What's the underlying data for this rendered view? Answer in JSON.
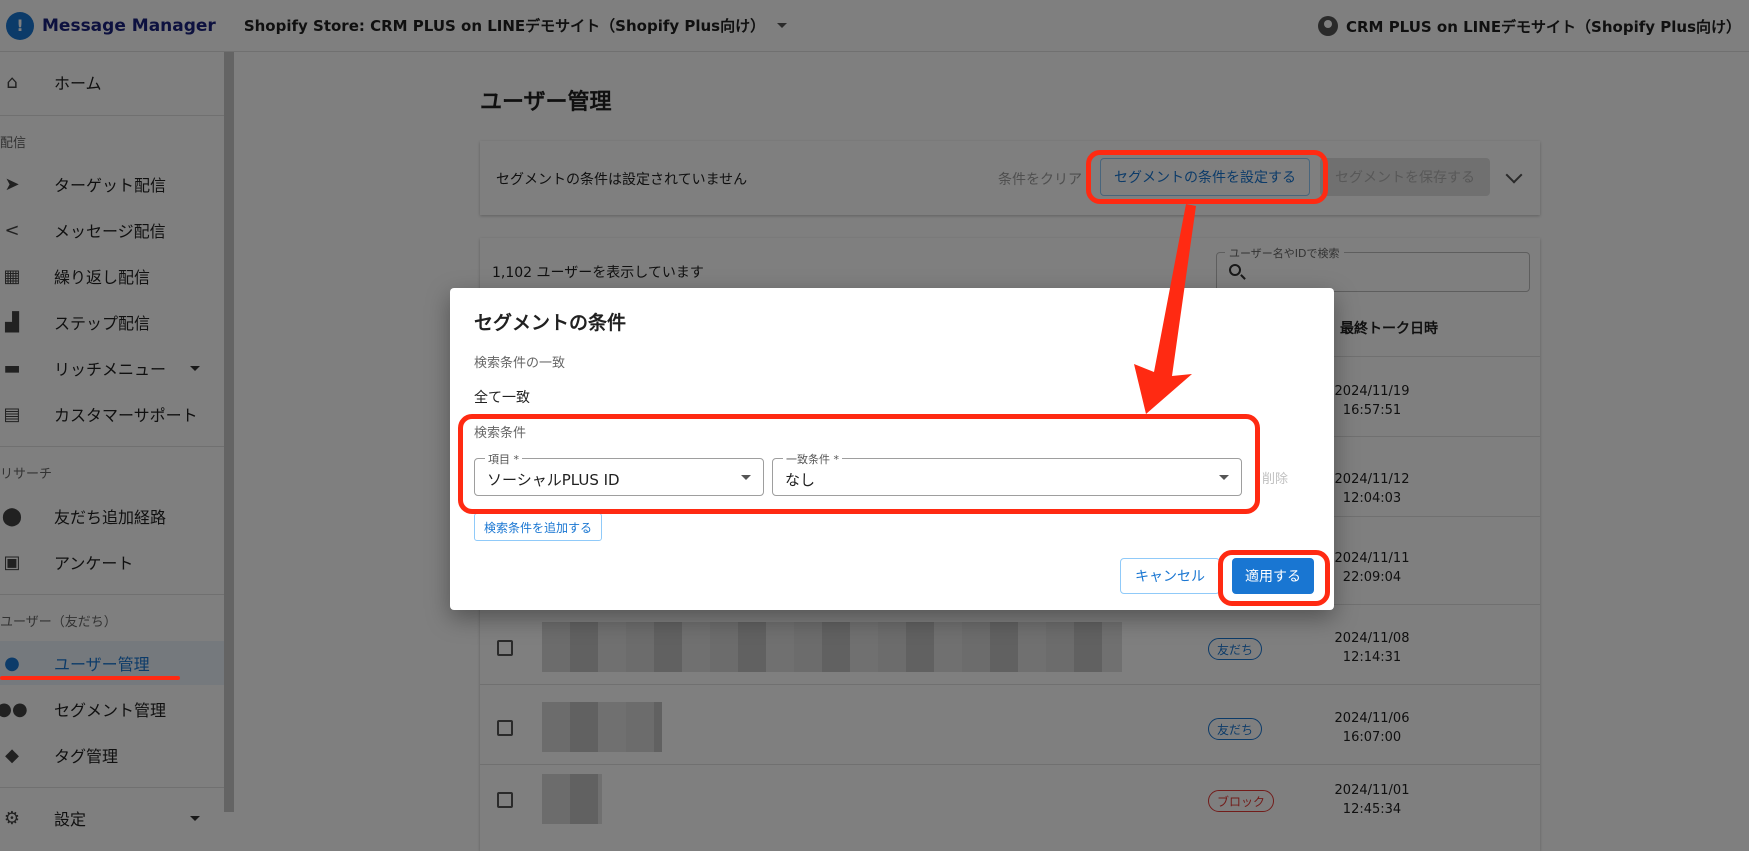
{
  "topbar": {
    "app_title": "Message Manager",
    "store": "Shopify Store: CRM PLUS on LINEデモサイト（Shopify Plus向け）",
    "account": "CRM PLUS on LINEデモサイト（Shopify Plus向け）"
  },
  "sidebar": {
    "home": "ホーム",
    "section_delivery": "配信",
    "target": "ターゲット配信",
    "message": "メッセージ配信",
    "repeat": "繰り返し配信",
    "step": "ステップ配信",
    "rich_menu": "リッチメニュー",
    "support": "カスタマーサポート",
    "section_research": "リサーチ",
    "friend_route": "友だち追加経路",
    "survey": "アンケート",
    "section_users": "ユーザー（友だち）",
    "user_mgmt": "ユーザー管理",
    "segment_mgmt": "セグメント管理",
    "tag_mgmt": "タグ管理",
    "settings": "設定"
  },
  "main": {
    "title": "ユーザー管理",
    "segment_status": "セグメントの条件は設定されていません",
    "clear": "条件をクリア",
    "set_segment": "セグメントの条件を設定する",
    "save_segment": "セグメントを保存する",
    "count": "1,102 ユーザーを表示しています",
    "search_label": "ユーザー名やIDで検索",
    "col_last_talk": "最終トーク日時",
    "rows": [
      {
        "date": "2024/11/19",
        "time": "16:57:51"
      },
      {
        "date": "2024/11/12",
        "time": "12:04:03"
      },
      {
        "date": "2024/11/11",
        "time": "22:09:04"
      },
      {
        "date": "2024/11/08",
        "time": "12:14:31",
        "status": "友だち"
      },
      {
        "date": "2024/11/06",
        "time": "16:07:00",
        "status": "友だち"
      },
      {
        "date": "2024/11/01",
        "time": "12:45:34",
        "status": "ブロック"
      }
    ]
  },
  "dialog": {
    "title": "セグメントの条件",
    "match_label": "検索条件の一致",
    "match_value": "全て一致",
    "cond_label": "検索条件",
    "item_legend": "項目 *",
    "item_value": "ソーシャルPLUS ID",
    "match_legend": "一致条件 *",
    "match_cond_value": "なし",
    "delete": "削除",
    "add_condition": "検索条件を追加する",
    "cancel": "キャンセル",
    "apply": "適用する"
  }
}
